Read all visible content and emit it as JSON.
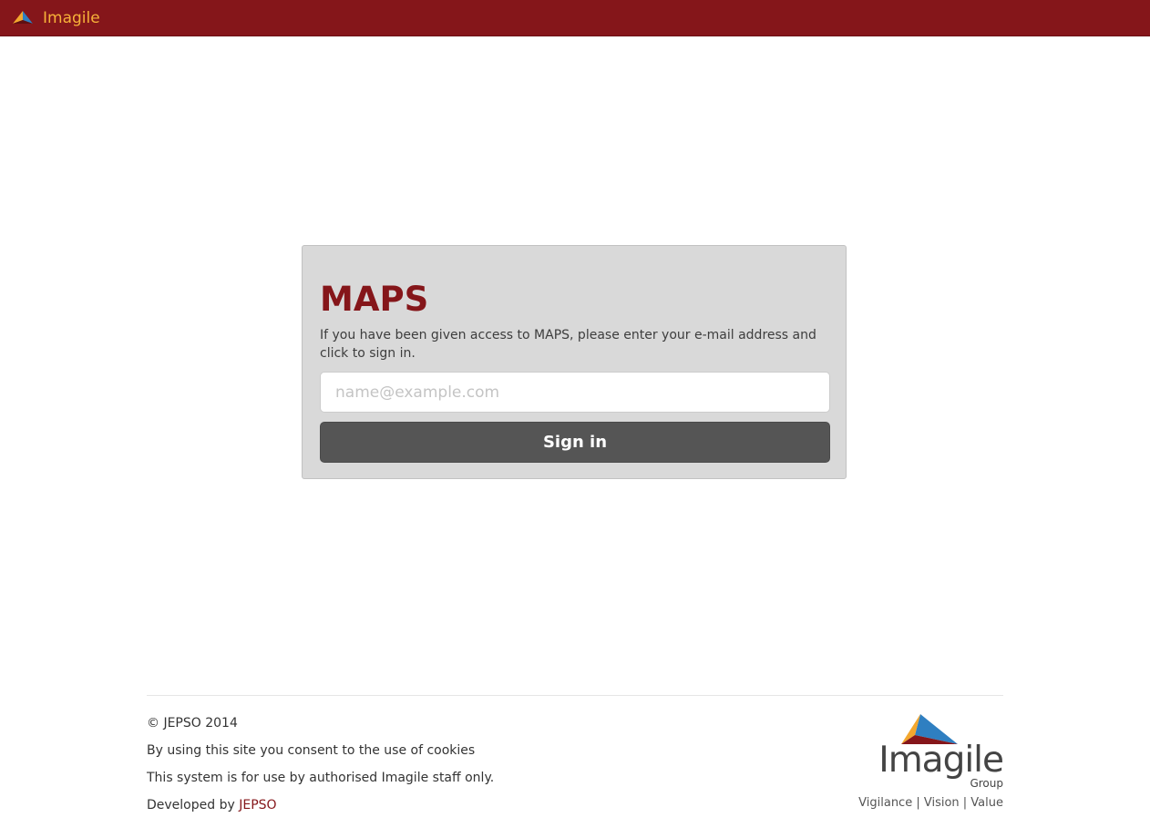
{
  "header": {
    "brand_name": "Imagile",
    "brand_color": "#85161a",
    "brand_text_color": "#f7b239",
    "logo_icon": "imagile-logo-icon"
  },
  "login": {
    "title": "MAPS",
    "description": "If you have been given access to MAPS, please enter your e-mail address and click to sign in.",
    "email_placeholder": "name@example.com",
    "email_value": "",
    "signin_label": "Sign in"
  },
  "footer": {
    "copyright": "© JEPSO 2014",
    "cookies_notice": "By using this site you consent to the use of cookies",
    "staff_notice": "This system is for use by authorised Imagile staff only.",
    "developed_by_prefix": "Developed by",
    "developed_by_link": "JEPSO",
    "logo": {
      "wordmark": "Imagile",
      "group": "Group",
      "tagline": "Vigilance | Vision | Value"
    }
  }
}
